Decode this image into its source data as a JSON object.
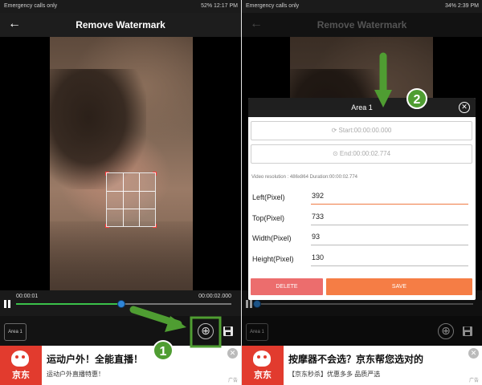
{
  "screen1": {
    "status": {
      "left": "Emergency calls only",
      "right": "52% 12:17 PM"
    },
    "appbar": {
      "back_icon": "←",
      "title": "Remove Watermark"
    },
    "player": {
      "time_start": "00:00:01",
      "time_end": "00:00:02.000",
      "progress": 0.49
    },
    "area_chip": "Area 1",
    "add_icon": "⊕",
    "ad": {
      "brand": "京东",
      "headline": "运动户外！全能直播！",
      "sub": "运动户外直播特惠！",
      "close": "✕",
      "tag": "广告"
    }
  },
  "screen2": {
    "status": {
      "left": "Emergency calls only",
      "right": "34% 2:39 PM"
    },
    "appbar": {
      "back_icon": "←",
      "title": "Remove Watermark"
    },
    "dialog": {
      "title": "Area 1",
      "close": "✕",
      "start": "Start:00:00:00.000",
      "end": "End:00:00:02.774",
      "video_info": "Video resolution : 486x864 Duration:00:00:02.774",
      "fields": [
        {
          "label": "Left(Pixel)",
          "value": "392"
        },
        {
          "label": "Top(Pixel)",
          "value": "733"
        },
        {
          "label": "Width(Pixel)",
          "value": "93"
        },
        {
          "label": "Height(Pixel)",
          "value": "130"
        }
      ],
      "delete": "DELETE",
      "save": "SAVE"
    },
    "area_chip": "Area 1",
    "add_icon": "⊕",
    "ad": {
      "brand": "京东",
      "headline": "按摩器不会选？京东帮您选对的",
      "sub": "【京东秒杀】优惠多多 品质严选",
      "close": "✕",
      "tag": "广告"
    }
  },
  "annotations": {
    "step1": "1",
    "step2": "2"
  },
  "colors": {
    "accent_green": "#4f9d32",
    "delete": "#ec6d6d",
    "save": "#f57d45",
    "progress": "#3bc14a"
  }
}
